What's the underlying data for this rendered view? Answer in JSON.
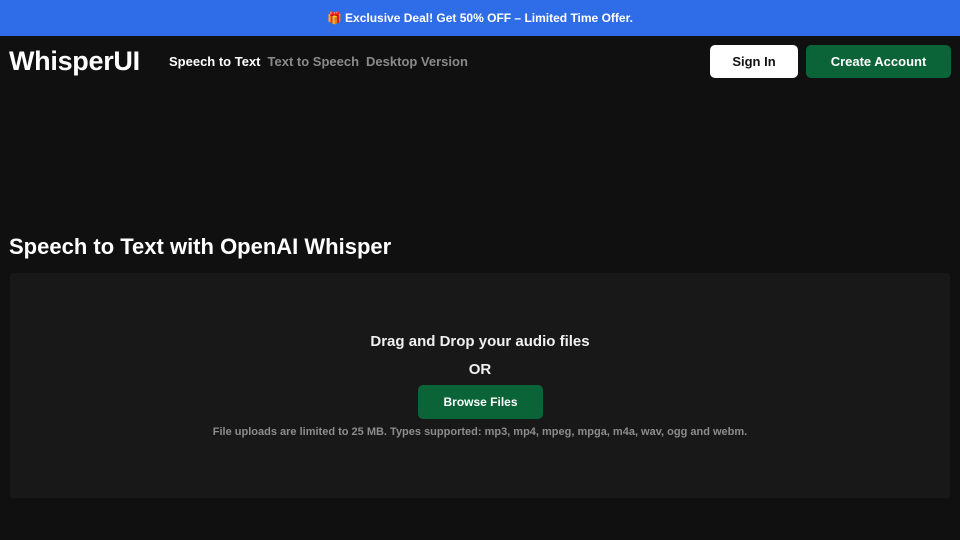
{
  "promo": {
    "icon": "gift-icon",
    "text": "Exclusive Deal! Get 50% OFF – Limited Time Offer."
  },
  "header": {
    "logo": "WhisperUI",
    "nav": [
      {
        "label": "Speech to Text",
        "active": true
      },
      {
        "label": "Text to Speech",
        "active": false
      },
      {
        "label": "Desktop Version",
        "active": false
      }
    ],
    "sign_in": "Sign In",
    "create_account": "Create Account"
  },
  "main": {
    "title": "Speech to Text with OpenAI Whisper",
    "dropzone": {
      "heading": "Drag and Drop your audio files",
      "or": "OR",
      "browse": "Browse Files",
      "note": "File uploads are limited to 25 MB. Types supported: mp3, mp4, mpeg, mpga, m4a, wav, ogg and webm."
    }
  },
  "colors": {
    "background": "#101010",
    "promo_bar": "#2f6de8",
    "accent_green": "#0b6437",
    "dropzone": "#181818"
  }
}
